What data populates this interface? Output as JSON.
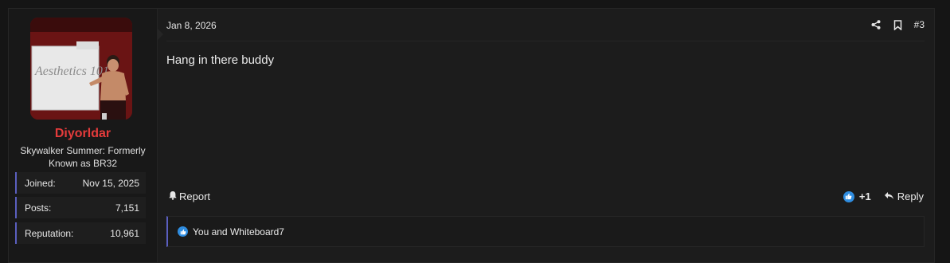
{
  "user": {
    "username": "Diyorldar",
    "title": "Skywalker Summer: Formerly Known as BR32",
    "avatar_text": "Aesthetics 101",
    "stats": [
      {
        "key": "Joined:",
        "value": "Nov 15, 2025"
      },
      {
        "key": "Posts:",
        "value": "7,151"
      },
      {
        "key": "Reputation:",
        "value": "10,961"
      }
    ]
  },
  "post": {
    "date": "Jan 8, 2026",
    "number": "#3",
    "message": "Hang in there buddy"
  },
  "actions": {
    "report": "Report",
    "reaction_count": "+1",
    "reply": "Reply",
    "reactions_summary": "You and Whiteboard7"
  },
  "icons": {
    "share": "share-icon",
    "bookmark": "bookmark-icon",
    "bell": "bell-icon",
    "like": "thumbs-up-icon",
    "reply": "reply-arrow-icon"
  },
  "colors": {
    "username": "#e43b3b",
    "accent_border": "#5a5fbf",
    "like_blue": "#2f8de0"
  }
}
